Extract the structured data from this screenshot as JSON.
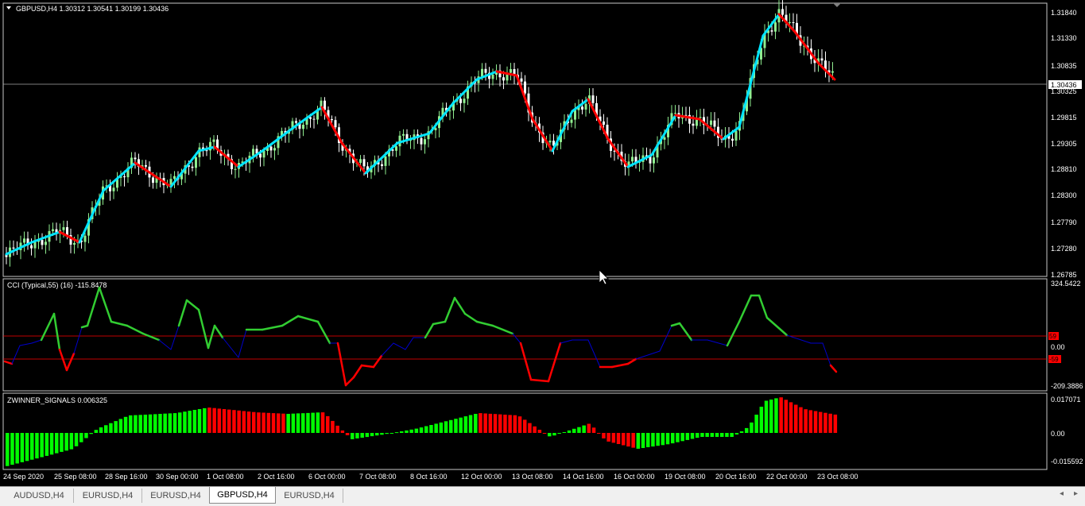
{
  "main_chart": {
    "header": "GBPUSD,H4  1.30312 1.30541 1.30199 1.30436",
    "price_labels": [
      "1.31840",
      "1.31330",
      "1.30835",
      "1.30325",
      "1.29815",
      "1.29305",
      "1.28810",
      "1.28300",
      "1.27790",
      "1.27280",
      "1.26785"
    ],
    "current_price": "1.30436",
    "colors": {
      "bull": "#90ee90",
      "bear": "#ffffff",
      "line_up": "#00e5ff",
      "line_down": "#ff0000"
    }
  },
  "cci_panel": {
    "header": "CCI (Typical,55) (16) -115.8478",
    "labels": {
      "top": "324.5422",
      "upper_level": "59",
      "zero": "0.00",
      "lower_level": "-59",
      "bottom": "-209.3886"
    },
    "colors": {
      "bull": "#32cd32",
      "bear": "#ff0000",
      "neutral": "#0000cd",
      "level_line": "#ff0000"
    }
  },
  "signals_panel": {
    "header": "ZWINNER_SIGNALS 0.006325",
    "labels": {
      "top": "0.017071",
      "zero": "0.00",
      "bottom": "-0.015592"
    },
    "colors": {
      "bull": "#00ff00",
      "bear": "#ff0000"
    }
  },
  "time_axis": [
    "24 Sep 2020",
    "25 Sep 08:00",
    "28 Sep 16:00",
    "30 Sep 00:00",
    "1 Oct 08:00",
    "2 Oct 16:00",
    "6 Oct 00:00",
    "7 Oct 08:00",
    "8 Oct 16:00",
    "12 Oct 00:00",
    "13 Oct 08:00",
    "14 Oct 16:00",
    "16 Oct 00:00",
    "19 Oct 08:00",
    "20 Oct 16:00",
    "22 Oct 00:00",
    "23 Oct 08:00"
  ],
  "tabs": [
    {
      "label": "AUDUSD,H4",
      "active": false
    },
    {
      "label": "EURUSD,H4",
      "active": false
    },
    {
      "label": "EURUSD,H4",
      "active": false
    },
    {
      "label": "GBPUSD,H4",
      "active": true
    },
    {
      "label": "EURUSD,H4",
      "active": false
    }
  ],
  "nav_prev": "◂",
  "nav_next": "▸"
}
